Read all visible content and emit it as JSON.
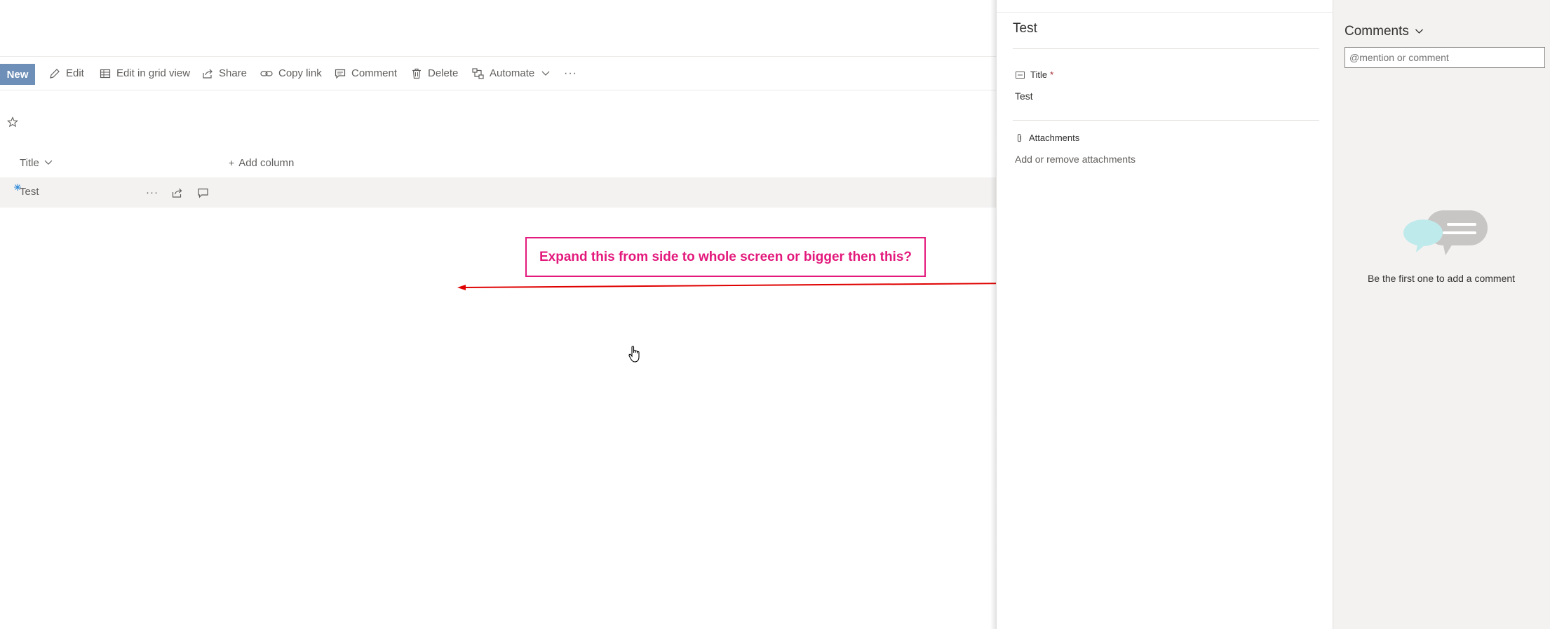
{
  "toolbar": {
    "new_label": "New",
    "edit_label": "Edit",
    "grid_label": "Edit in grid view",
    "share_label": "Share",
    "copy_link_label": "Copy link",
    "comment_label": "Comment",
    "delete_label": "Delete",
    "automate_label": "Automate",
    "more_label": "···"
  },
  "list": {
    "columns": [
      "Title"
    ],
    "add_column_label": "Add column",
    "rows": [
      {
        "title": "Test"
      }
    ],
    "more_label": "···"
  },
  "annotation": {
    "text": "Expand this from side to whole screen or bigger then this?",
    "color": "#e3197c",
    "arrow_color": "#e00000"
  },
  "details_panel": {
    "header": "Test",
    "title_field": {
      "label": "Title",
      "required_marker": "*",
      "value": "Test"
    },
    "attachments": {
      "label": "Attachments",
      "action": "Add or remove attachments"
    }
  },
  "comments_panel": {
    "header": "Comments",
    "input_placeholder": "@mention or comment",
    "empty_text": "Be the first one to add a comment"
  },
  "colors": {
    "new_button": "#6d8fb8",
    "accent": "#e3197c",
    "required": "#a4262c"
  }
}
